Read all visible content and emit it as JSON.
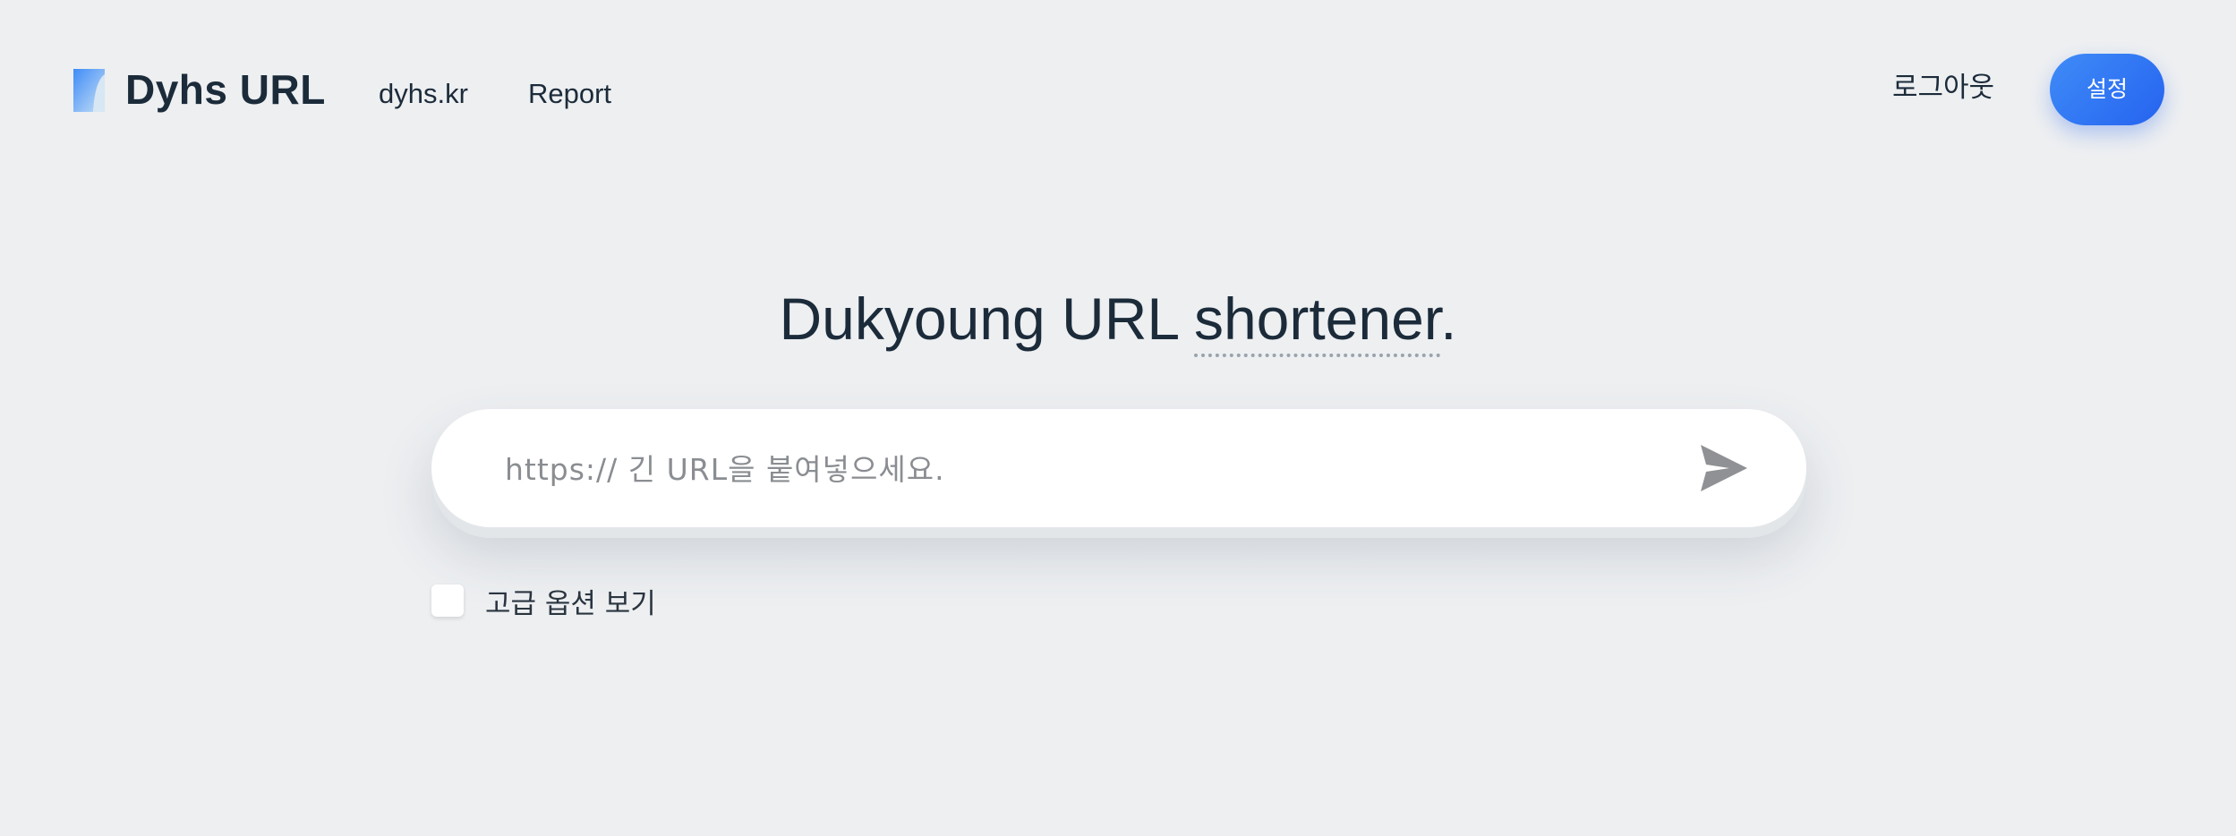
{
  "header": {
    "brand": "Dyhs URL",
    "nav": [
      {
        "label": "dyhs.kr"
      },
      {
        "label": "Report"
      }
    ],
    "logout_label": "로그아웃",
    "settings_label": "설정"
  },
  "hero": {
    "headline_prefix": "Dukyoung URL ",
    "headline_underlined": "shortener",
    "headline_suffix": "."
  },
  "search": {
    "placeholder": "https:// 긴 URL을 붙여넣으세요.",
    "value": "",
    "send_icon": "paper-plane-icon"
  },
  "options": {
    "advanced_label": "고급 옵션 보기",
    "advanced_checked": false
  },
  "colors": {
    "background": "#edeff1",
    "accent": "#2f6ff3",
    "text": "#1c2b3a"
  }
}
